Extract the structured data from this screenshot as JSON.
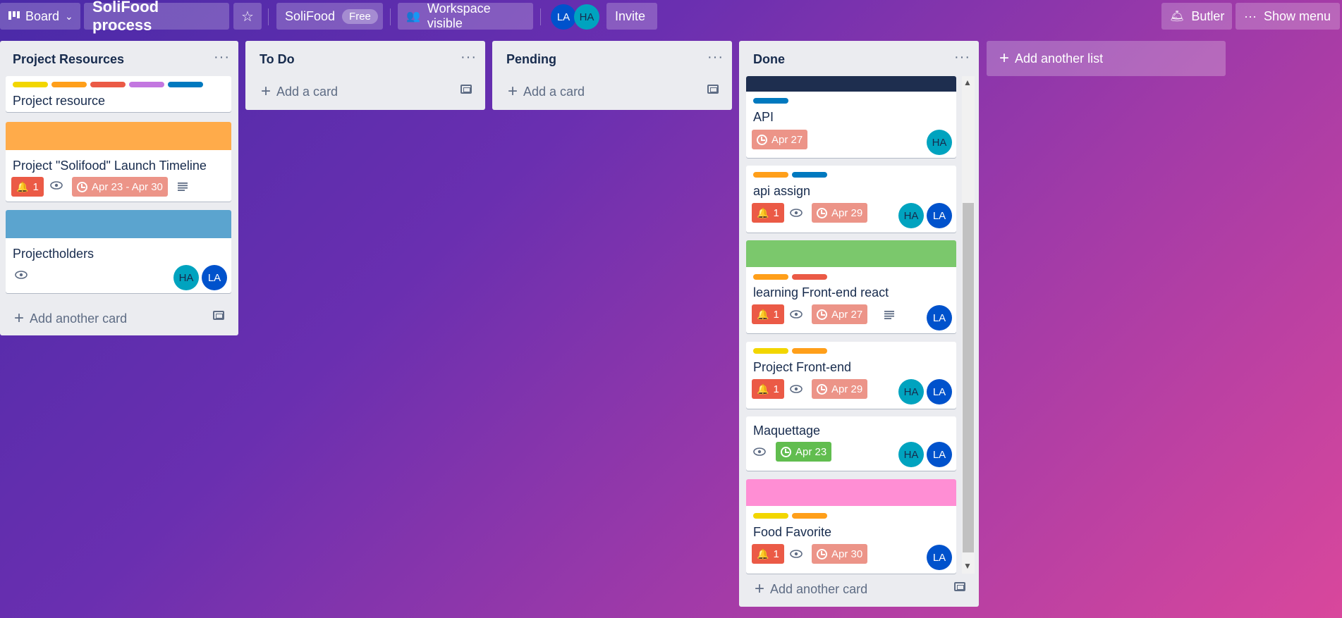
{
  "header": {
    "view_label": "Board",
    "board_title": "SoliFood process",
    "workspace_name": "SoliFood",
    "workspace_badge": "Free",
    "visibility_label": "Workspace visible",
    "members": [
      "LA",
      "HA"
    ],
    "invite_label": "Invite",
    "butler_label": "Butler",
    "menu_label": "Show menu"
  },
  "colors": {
    "yellow": "#f2d600",
    "orange": "#ff9f1a",
    "red": "#eb5a46",
    "purple": "#c377e0",
    "blue": "#0079bf",
    "navy": "#1e2e4f",
    "cover_orange": "#ffab4a",
    "cover_blue": "#5ba4cf",
    "cover_green": "#7bc86c",
    "cover_pink": "#ff8ed4"
  },
  "lists": [
    {
      "title": "Project Resources",
      "add_label": "Add another card",
      "cards": [
        {
          "title": "Project resource",
          "labels": [
            "yellow",
            "orange",
            "red",
            "purple",
            "blue"
          ]
        },
        {
          "title": "Project \"Solifood\" Launch Timeline",
          "cover": "cover_orange",
          "notif": "1",
          "due": "Apr 23 - Apr 30",
          "watch": true,
          "desc": true
        },
        {
          "title": "Projectholders",
          "cover": "cover_blue",
          "watch": true,
          "members": [
            "HA",
            "LA"
          ]
        }
      ]
    },
    {
      "title": "To Do",
      "add_label": "Add a card",
      "cards": []
    },
    {
      "title": "Pending",
      "add_label": "Add a card",
      "cards": []
    },
    {
      "title": "Done",
      "add_label": "Add another card",
      "cards": [
        {
          "title": "API",
          "cover": "navy",
          "labels": [
            "blue"
          ],
          "due": "Apr 27",
          "members": [
            "HA"
          ]
        },
        {
          "title": "api assign",
          "labels": [
            "orange",
            "blue"
          ],
          "notif": "1",
          "watch": true,
          "due": "Apr 29",
          "members": [
            "HA",
            "LA"
          ]
        },
        {
          "title": "learning Front-end react",
          "cover": "cover_green",
          "labels": [
            "orange",
            "red"
          ],
          "notif": "1",
          "watch": true,
          "due": "Apr 27",
          "desc": true,
          "members": [
            "LA"
          ]
        },
        {
          "title": "Project Front-end",
          "labels": [
            "yellow",
            "orange"
          ],
          "notif": "1",
          "watch": true,
          "due": "Apr 29",
          "members": [
            "HA",
            "LA"
          ]
        },
        {
          "title": "Maquettage",
          "watch": true,
          "due": "Apr 23",
          "due_complete": true,
          "members": [
            "HA",
            "LA"
          ]
        },
        {
          "title": "Food Favorite",
          "cover": "cover_pink",
          "labels": [
            "yellow",
            "orange"
          ],
          "notif": "1",
          "watch": true,
          "due": "Apr 30",
          "members": [
            "LA"
          ]
        }
      ]
    }
  ],
  "add_list_label": "Add another list"
}
